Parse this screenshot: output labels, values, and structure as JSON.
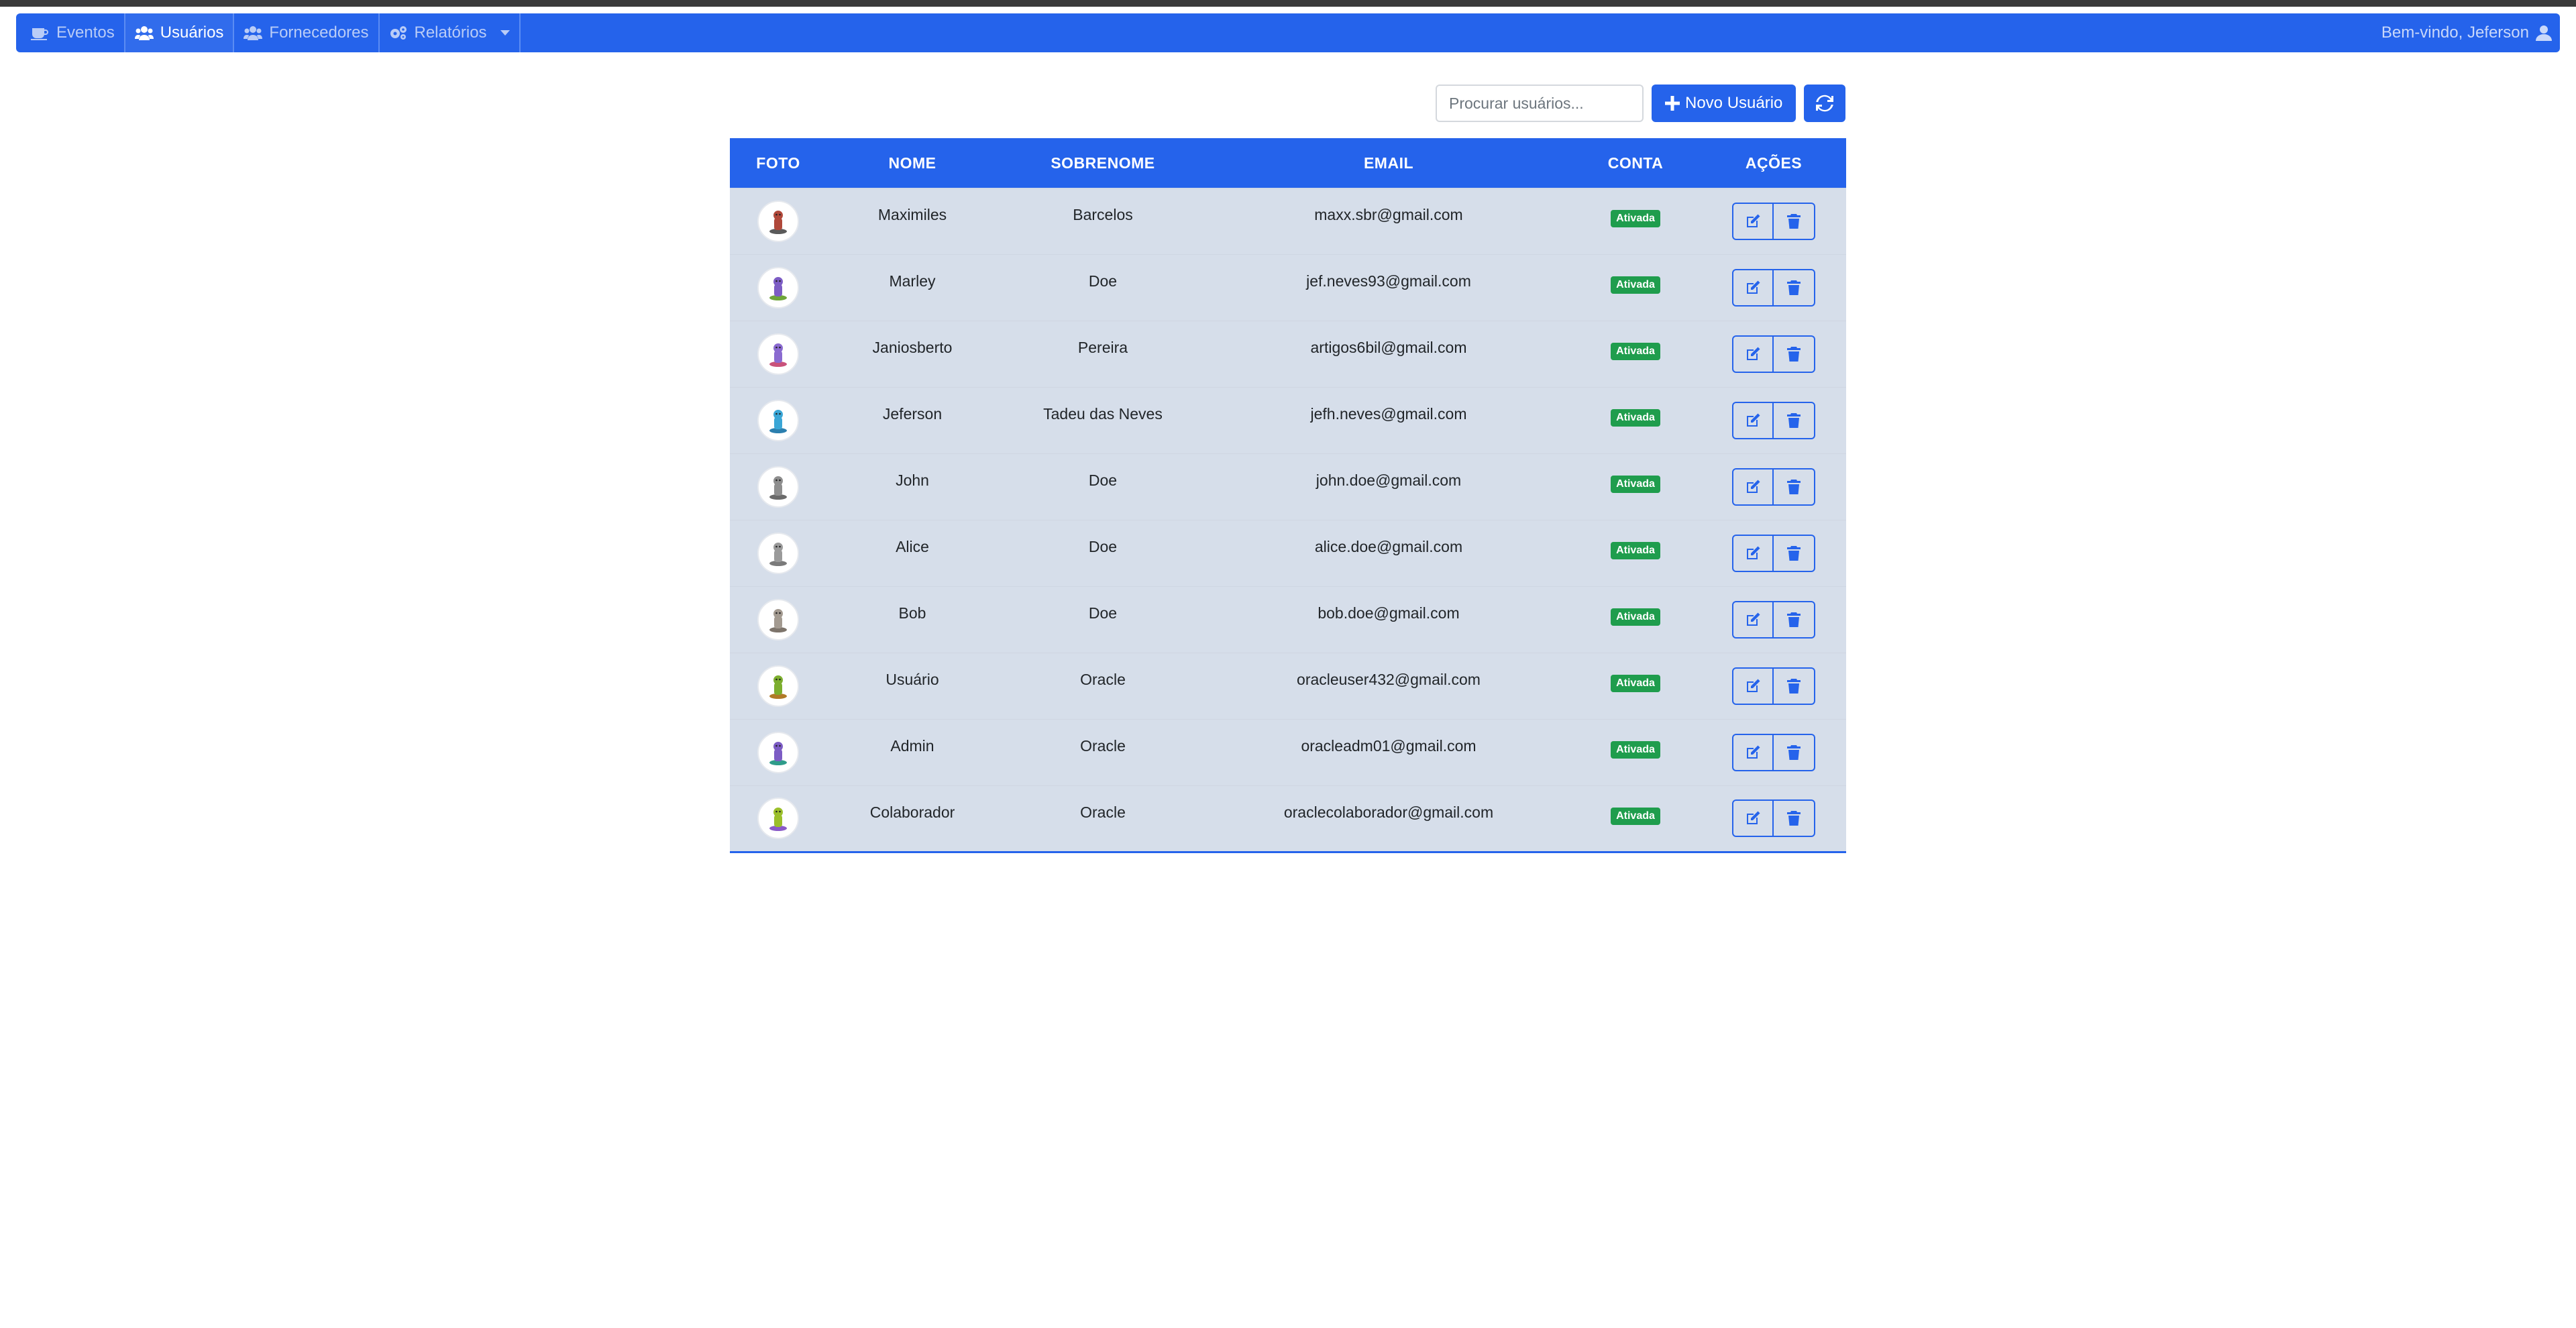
{
  "nav": {
    "items": [
      {
        "label": "Eventos",
        "icon": "coffee-icon"
      },
      {
        "label": "Usuários",
        "icon": "users-icon"
      },
      {
        "label": "Fornecedores",
        "icon": "users-icon"
      },
      {
        "label": "Relatórios",
        "icon": "cogs-icon"
      }
    ],
    "welcome": "Bem-vindo, Jeferson"
  },
  "toolbar": {
    "search_placeholder": "Procurar usuários...",
    "new_user_label": "Novo Usuário"
  },
  "table": {
    "headers": [
      "FOTO",
      "NOME",
      "SOBRENOME",
      "EMAIL",
      "CONTA",
      "AÇÕES"
    ],
    "rows": [
      {
        "first": "Maximiles",
        "last": "Barcelos",
        "email": "maxx.sbr@gmail.com",
        "status": "Ativada",
        "avatar_color": "#b0483a",
        "avatar_base": "#5a5a5a"
      },
      {
        "first": "Marley",
        "last": "Doe",
        "email": "jef.neves93@gmail.com",
        "status": "Ativada",
        "avatar_color": "#7c5cc4",
        "avatar_base": "#6ea53a"
      },
      {
        "first": "Janiosberto",
        "last": "Pereira",
        "email": "artigos6bil@gmail.com",
        "status": "Ativada",
        "avatar_color": "#8a6ad0",
        "avatar_base": "#c9527b"
      },
      {
        "first": "Jeferson",
        "last": "Tadeu das Neves",
        "email": "jefh.neves@gmail.com",
        "status": "Ativada",
        "avatar_color": "#3aa6d6",
        "avatar_base": "#2b7fae"
      },
      {
        "first": "John",
        "last": "Doe",
        "email": "john.doe@gmail.com",
        "status": "Ativada",
        "avatar_color": "#8e8e8e",
        "avatar_base": "#6a6a6a"
      },
      {
        "first": "Alice",
        "last": "Doe",
        "email": "alice.doe@gmail.com",
        "status": "Ativada",
        "avatar_color": "#9a9a9a",
        "avatar_base": "#7a7a7a"
      },
      {
        "first": "Bob",
        "last": "Doe",
        "email": "bob.doe@gmail.com",
        "status": "Ativada",
        "avatar_color": "#a39a90",
        "avatar_base": "#7d746b"
      },
      {
        "first": "Usuário",
        "last": "Oracle",
        "email": "oracleuser432@gmail.com",
        "status": "Ativada",
        "avatar_color": "#7cae2e",
        "avatar_base": "#b07a28"
      },
      {
        "first": "Admin",
        "last": "Oracle",
        "email": "oracleadm01@gmail.com",
        "status": "Ativada",
        "avatar_color": "#7c5cc4",
        "avatar_base": "#2f9c8a"
      },
      {
        "first": "Colaborador",
        "last": "Oracle",
        "email": "oraclecolaborador@gmail.com",
        "status": "Ativada",
        "avatar_color": "#9bbf2a",
        "avatar_base": "#8a5ac8"
      }
    ]
  },
  "colors": {
    "primary": "#2563eb",
    "row_bg": "#d6deea",
    "badge_green": "#1f9d4d"
  }
}
